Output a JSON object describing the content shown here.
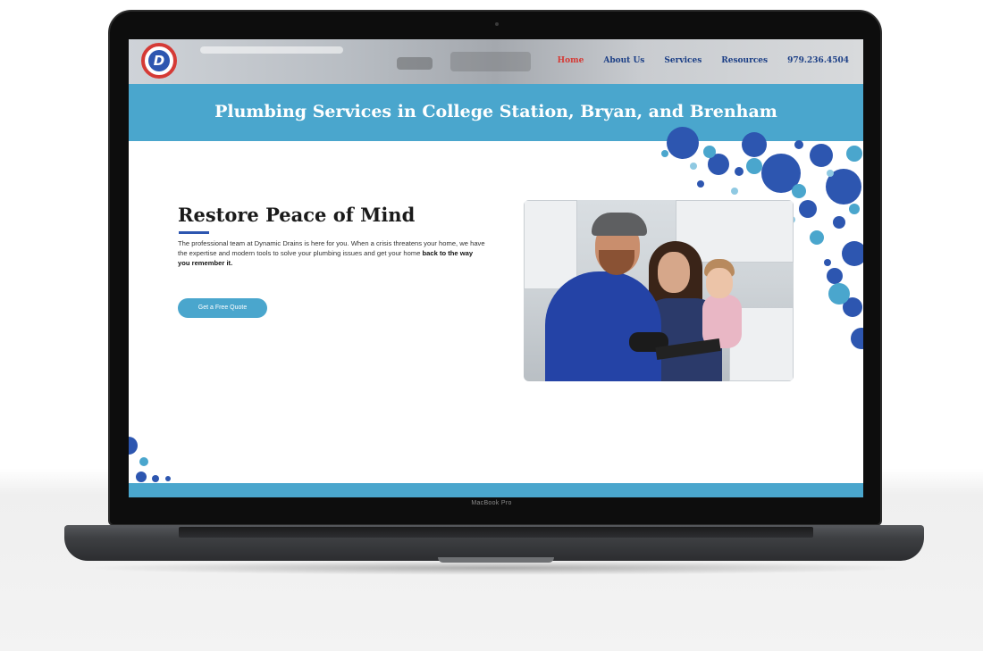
{
  "device": {
    "label": "MacBook Pro"
  },
  "site": {
    "logo_letter": "D",
    "nav": {
      "home": "Home",
      "about": "About Us",
      "services": "Services",
      "resources": "Resources",
      "phone": "979.236.4504"
    },
    "hero_title": "Plumbing Services in College Station, Bryan, and Brenham",
    "content": {
      "heading": "Restore Peace of Mind",
      "paragraph_main": "The professional team at Dynamic Drains is here for you. When a crisis threatens your home, we have the expertise and modern tools to solve your plumbing issues and get your home ",
      "paragraph_bold": "back to the way you remember it.",
      "cta_label": "Get a Free Quote"
    }
  },
  "colors": {
    "accent_blue": "#4aa6cd",
    "brand_navy": "#1c3f86",
    "brand_red": "#d53a35",
    "dot_blue": "#2d56b0"
  }
}
